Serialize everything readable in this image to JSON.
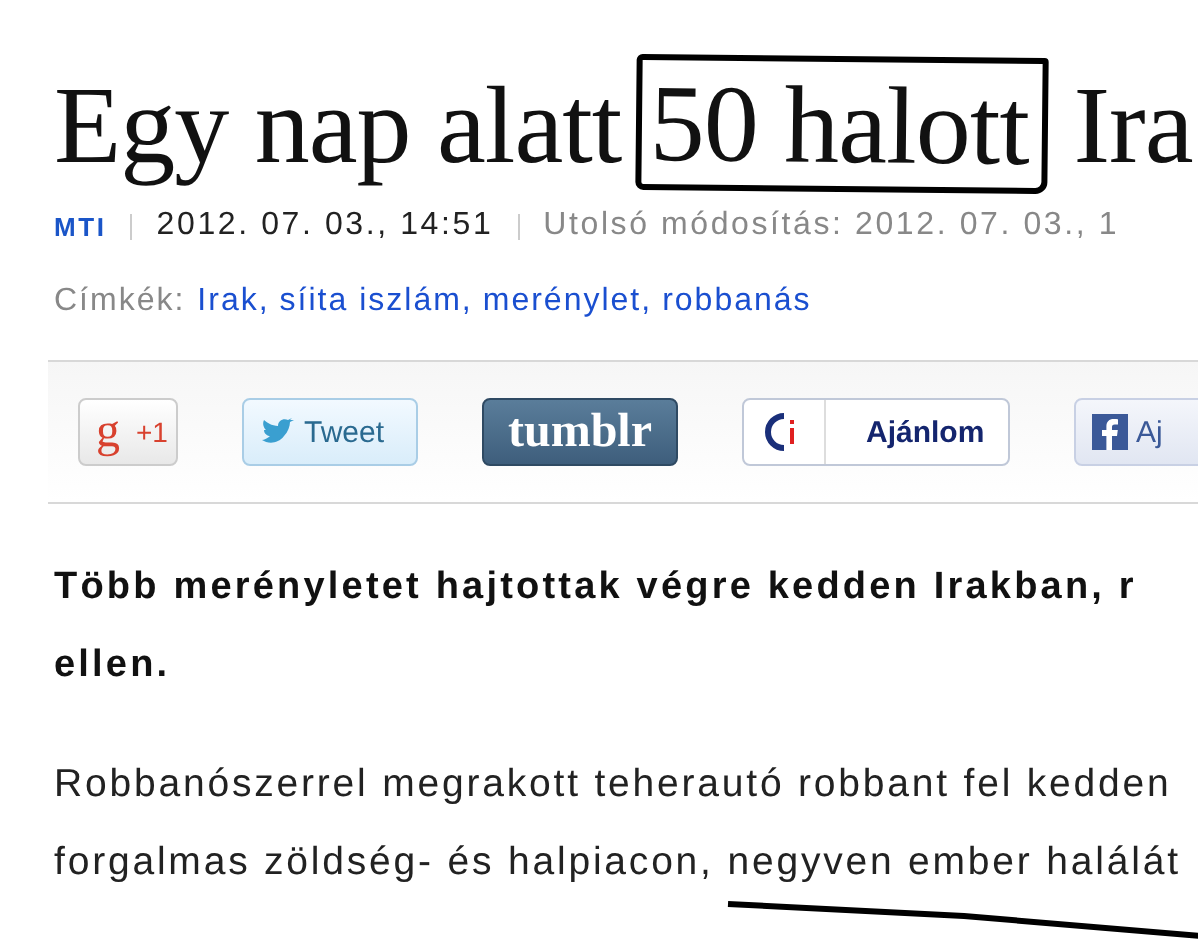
{
  "headline": {
    "before": "Egy nap alatt",
    "marked": "50 halott",
    "after": "Ira"
  },
  "meta": {
    "source": "MTI",
    "published": "2012. 07. 03., 14:51",
    "modified": "Utolsó módosítás: 2012. 07. 03., 1"
  },
  "tags": {
    "label": "Címkék:",
    "separator": ",",
    "items": [
      "Irak",
      "síita iszlám",
      "merénylet",
      "robbanás"
    ]
  },
  "share_buttons": [
    {
      "kind": "gplus",
      "logo": "g",
      "label": "+1"
    },
    {
      "kind": "tweet",
      "label": "Tweet"
    },
    {
      "kind": "tumblr",
      "label": "tumblr"
    },
    {
      "kind": "ajanlom",
      "label": "Ajánlom"
    },
    {
      "kind": "facebook",
      "label": "Aj"
    }
  ],
  "lead": [
    "Több merényletet hajtottak végre kedden Irakban, r",
    "ellen."
  ],
  "body": [
    {
      "text": "Robbanószerrel megrakott teherautó robbant fel kedden"
    },
    {
      "text": "forgalmas zöldség- és halpiacon, ",
      "underlined": "negyven ember halálát"
    }
  ]
}
